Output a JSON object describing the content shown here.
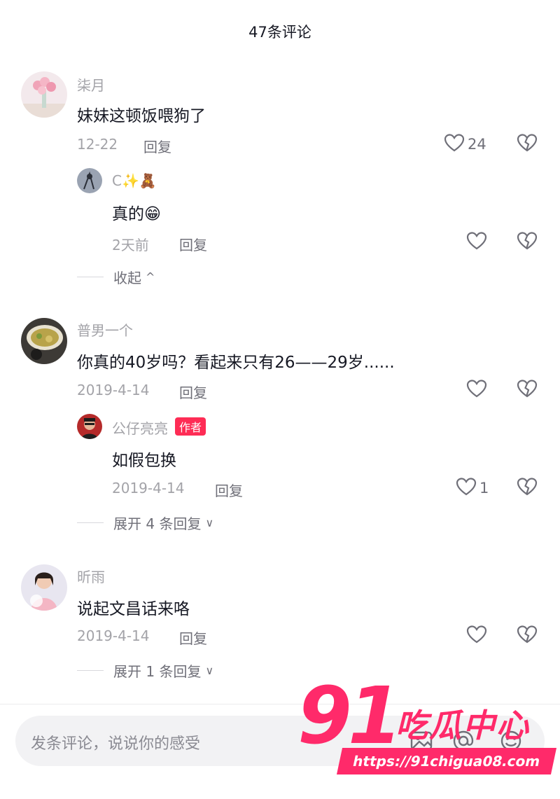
{
  "header": {
    "title": "47条评论"
  },
  "comments": [
    {
      "username": "柒月",
      "content": "妹妹这顿饭喂狗了",
      "date": "12-22",
      "reply_label": "回复",
      "likes": "24",
      "replies": [
        {
          "username": "C✨🧸",
          "content": "真的😁",
          "date": "2天前",
          "reply_label": "回复",
          "likes": ""
        }
      ],
      "expand_label": "收起",
      "expand_chevron": "^"
    },
    {
      "username": "普男一个",
      "content": "你真的40岁吗？看起来只有26——29岁......",
      "date": "2019-4-14",
      "reply_label": "回复",
      "likes": "",
      "replies": [
        {
          "username": "公仔亮亮",
          "badge": "作者",
          "content": "如假包换",
          "date": "2019-4-14",
          "reply_label": "回复",
          "likes": "1"
        }
      ],
      "expand_label": "展开 4 条回复",
      "expand_chevron": "∨"
    },
    {
      "username": "昕雨",
      "content": "说起文昌话来咯",
      "date": "2019-4-14",
      "reply_label": "回复",
      "likes": "",
      "replies": [],
      "expand_label": "展开 1 条回复",
      "expand_chevron": "∨"
    }
  ],
  "input": {
    "placeholder": "发条评论，说说你的感受"
  },
  "watermark": {
    "number": "91",
    "text": "吃瓜中心",
    "url": "https://91chigua08.com"
  },
  "colors": {
    "accent": "#fe2c55",
    "muted": "#a3a3a8",
    "text": "#161823"
  }
}
